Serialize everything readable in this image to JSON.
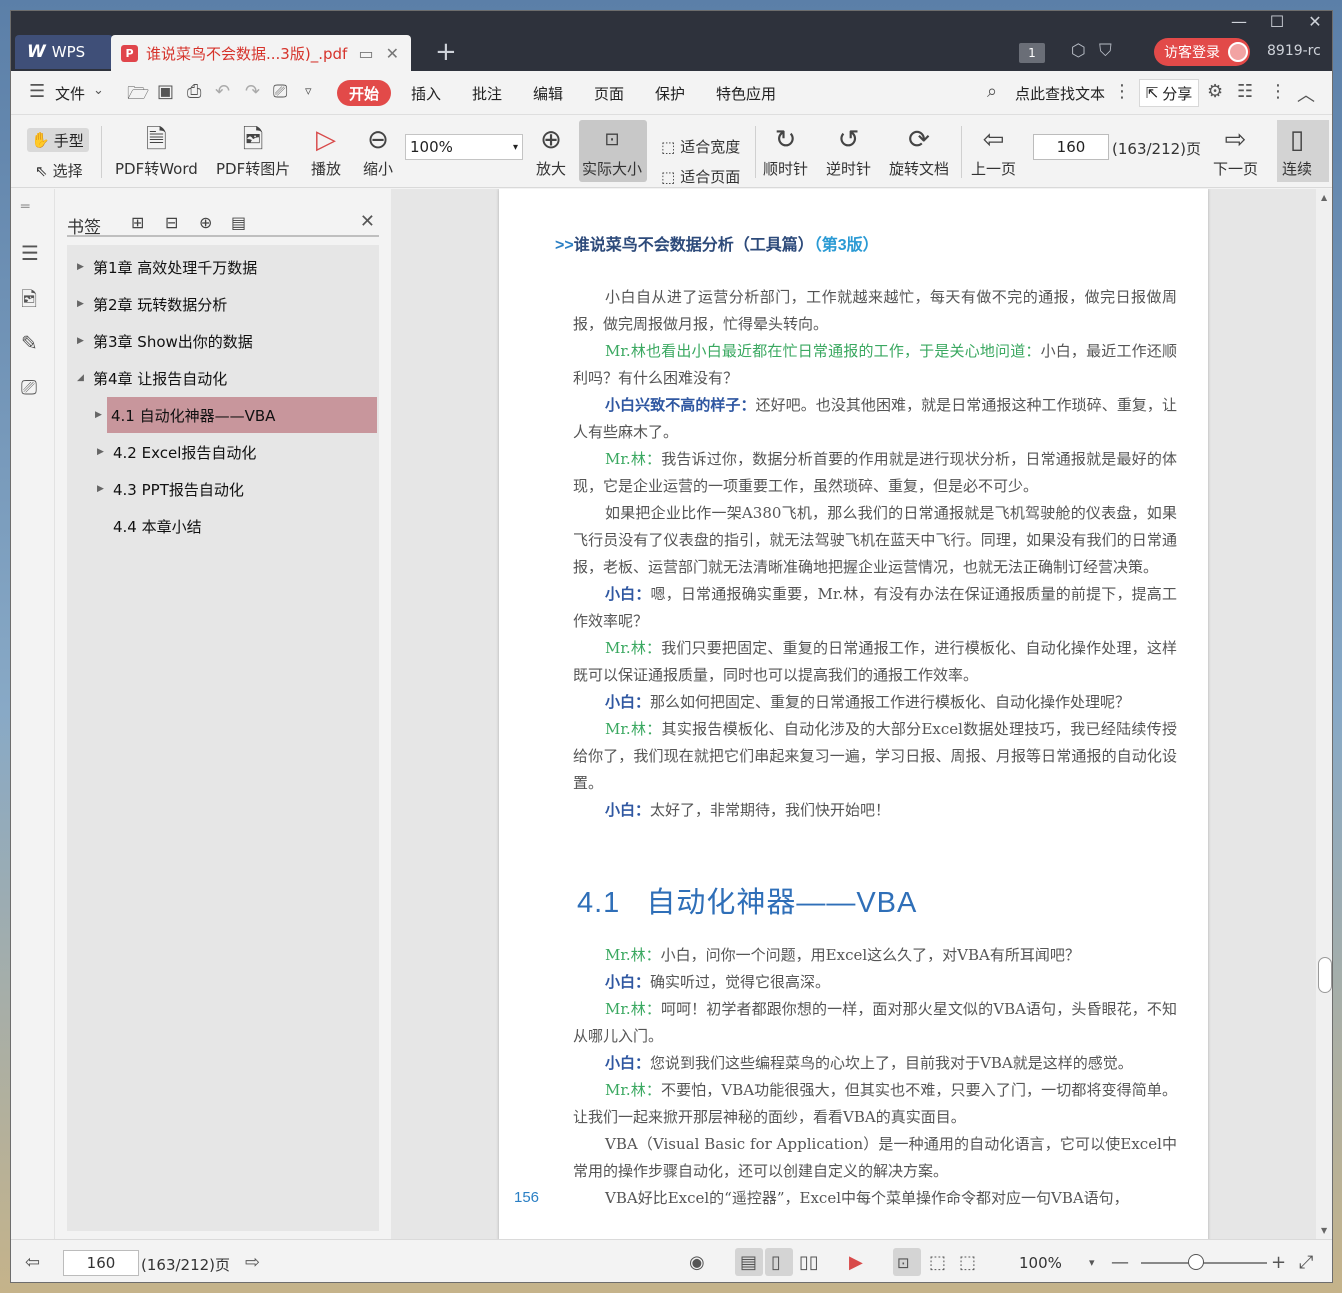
{
  "titlebar": {
    "app_name": "WPS",
    "doc_tab_title": "谁说菜鸟不会数据...3版)_.pdf",
    "new_tab": "+",
    "page_badge": "1",
    "guest_login": "访客登录",
    "version": "8919-rc"
  },
  "menu": {
    "file": "文件",
    "start": "开始",
    "insert": "插入",
    "annotate": "批注",
    "edit": "编辑",
    "page": "页面",
    "protect": "保护",
    "special": "特色应用",
    "search": "点此查找文本",
    "share": "分享"
  },
  "toolbar": {
    "hand": "手型",
    "select": "选择",
    "pdf_to_word": "PDF转Word",
    "pdf_to_image": "PDF转图片",
    "play": "播放",
    "zoom_out": "缩小",
    "zoom_value": "100%",
    "zoom_in": "放大",
    "actual_size": "实际大小",
    "fit_width": "适合宽度",
    "fit_page": "适合页面",
    "clockwise": "顺时针",
    "counterclockwise": "逆时针",
    "rotate_doc": "旋转文档",
    "prev_page": "上一页",
    "current_page": "160",
    "page_total": "(163/212)页",
    "next_page": "下一页",
    "continuous": "连续"
  },
  "bookmarks": {
    "title": "书签",
    "items": [
      {
        "label": "第1章 高效处理千万数据"
      },
      {
        "label": "第2章 玩转数据分析"
      },
      {
        "label": "第3章 Show出你的数据"
      },
      {
        "label": "第4章 让报告自动化"
      },
      {
        "label": "4.1 自动化神器——VBA"
      },
      {
        "label": "4.2 Excel报告自动化"
      },
      {
        "label": "4.3 PPT报告自动化"
      },
      {
        "label": "4.4 本章小结"
      }
    ]
  },
  "document": {
    "header_arrow": ">>",
    "header_title": "谁说菜鸟不会数据分析（工具篇）",
    "header_edition": "（第3版）",
    "paragraphs": [
      {
        "lead": "",
        "text": "小白自从进了运营分析部门，工作就越来越忙，每天有做不完的通报，做完日报做周报，做完周报做月报，忙得晕头转向。"
      },
      {
        "lead": "Mr.林也看出小白最近都在忙日常通报的工作，于是关心地问道：",
        "text": "小白，最近工作还顺利吗？有什么困难没有？"
      },
      {
        "lead": "小白兴致不高的样子：",
        "text": "还好吧。也没其他困难，就是日常通报这种工作琐碎、重复，让人有些麻木了。"
      },
      {
        "lead": "Mr.林：",
        "text": "我告诉过你，数据分析首要的作用就是进行现状分析，日常通报就是最好的体现，它是企业运营的一项重要工作，虽然琐碎、重复，但是必不可少。"
      },
      {
        "lead": "",
        "text": "如果把企业比作一架A380飞机，那么我们的日常通报就是飞机驾驶舱的仪表盘，如果飞行员没有了仪表盘的指引，就无法驾驶飞机在蓝天中飞行。同理，如果没有我们的日常通报，老板、运营部门就无法清晰准确地把握企业运营情况，也就无法正确制订经营决策。"
      },
      {
        "lead": "小白：",
        "text": "嗯，日常通报确实重要，Mr.林，有没有办法在保证通报质量的前提下，提高工作效率呢？"
      },
      {
        "lead": "Mr.林：",
        "text": "我们只要把固定、重复的日常通报工作，进行模板化、自动化操作处理，这样既可以保证通报质量，同时也可以提高我们的通报工作效率。"
      },
      {
        "lead": "小白：",
        "text": "那么如何把固定、重复的日常通报工作进行模板化、自动化操作处理呢？"
      },
      {
        "lead": "Mr.林：",
        "text": "其实报告模板化、自动化涉及的大部分Excel数据处理技巧，我已经陆续传授给你了，我们现在就把它们串起来复习一遍，学习日报、周报、月报等日常通报的自动化设置。"
      },
      {
        "lead": "小白：",
        "text": "太好了，非常期待，我们快开始吧！"
      }
    ],
    "section_number": "4.1",
    "section_title": "自动化神器——VBA",
    "paragraphs2": [
      {
        "lead": "Mr.林：",
        "text": "小白，问你一个问题，用Excel这么久了，对VBA有所耳闻吧？"
      },
      {
        "lead": "小白：",
        "text": "确实听过，觉得它很高深。"
      },
      {
        "lead": "Mr.林：",
        "text": "呵呵！初学者都跟你想的一样，面对那火星文似的VBA语句，头昏眼花，不知从哪儿入门。"
      },
      {
        "lead": "小白：",
        "text": "您说到我们这些编程菜鸟的心坎上了，目前我对于VBA就是这样的感觉。"
      },
      {
        "lead": "Mr.林：",
        "text": "不要怕，VBA功能很强大，但其实也不难，只要入了门，一切都将变得简单。让我们一起来掀开那层神秘的面纱，看看VBA的真实面目。"
      },
      {
        "lead": "",
        "text": "VBA（Visual Basic for Application）是一种通用的自动化语言，它可以使Excel中常用的操作步骤自动化，还可以创建自定义的解决方案。"
      },
      {
        "lead": "",
        "text": "VBA好比Excel的“遥控器”，Excel中每个菜单操作命令都对应一句VBA语句，"
      }
    ],
    "page_number": "156"
  },
  "statusbar": {
    "current_page": "160",
    "page_total": "(163/212)页",
    "zoom": "100%"
  }
}
